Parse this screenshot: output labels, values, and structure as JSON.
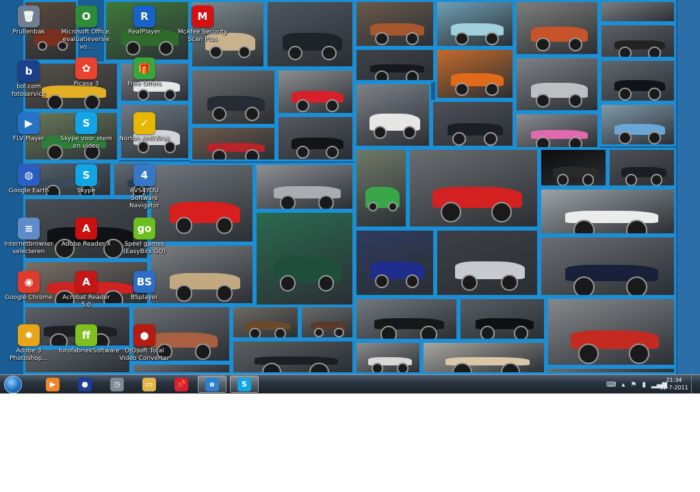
{
  "desktop": {
    "icons": [
      {
        "label": "Prullenbak",
        "icon": "recycle-bin-icon",
        "color": "#6f7f91",
        "glyph": "🗑"
      },
      {
        "label": "Microsoft Office, evaluatieversie vo...",
        "icon": "office-icon",
        "color": "#2f8a3a",
        "glyph": "O"
      },
      {
        "label": "RealPlayer",
        "icon": "realplayer-icon",
        "color": "#1763c9",
        "glyph": "R"
      },
      {
        "label": "McAfee Security Scan Plus",
        "icon": "mcafee-icon",
        "color": "#d41010",
        "glyph": "M"
      },
      {
        "label": "bol.com fotoservice",
        "icon": "bolcom-icon",
        "color": "#1c3f8a",
        "glyph": "b"
      },
      {
        "label": "Picasa 3",
        "icon": "picasa-icon",
        "color": "#e8432f",
        "glyph": "✿"
      },
      {
        "label": "Free Offers",
        "icon": "gift-icon",
        "color": "#3aa63a",
        "glyph": "🎁"
      },
      {
        "label": "FLV Player",
        "icon": "flv-player-icon",
        "color": "#2672c4",
        "glyph": "▶"
      },
      {
        "label": "Skype voor stem en video",
        "icon": "skype-icon",
        "color": "#12a5e6",
        "glyph": "S"
      },
      {
        "label": "Norton AntiVirus",
        "icon": "norton-icon",
        "color": "#e6b800",
        "glyph": "✓"
      },
      {
        "label": "Google Earth",
        "icon": "google-earth-icon",
        "color": "#2a5ec2",
        "glyph": "◍"
      },
      {
        "label": "Skype",
        "icon": "skype-icon",
        "color": "#12a5e6",
        "glyph": "S"
      },
      {
        "label": "AVS4YOU Software Navigator",
        "icon": "avs-navigator-icon",
        "color": "#3578c6",
        "glyph": "4"
      },
      {
        "label": "Internetbrowser selecteren",
        "icon": "browser-select-icon",
        "color": "#5e8cc9",
        "glyph": "≡"
      },
      {
        "label": "Adobe Reader X",
        "icon": "adobe-reader-icon",
        "color": "#c81010",
        "glyph": "A"
      },
      {
        "label": "Speel games (EasyBits GO)",
        "icon": "easybits-go-icon",
        "color": "#6cbf1e",
        "glyph": "go"
      },
      {
        "label": "Google Chrome",
        "icon": "chrome-icon",
        "color": "#dd3b2b",
        "glyph": "◉"
      },
      {
        "label": "Acrobat Reader 5.0",
        "icon": "acrobat-icon",
        "color": "#c41616",
        "glyph": "A"
      },
      {
        "label": "BSplayer",
        "icon": "bsplayer-icon",
        "color": "#2c6ec7",
        "glyph": "BS"
      },
      {
        "label": "Adobe 3 Photoshop...",
        "icon": "photoshop-album-icon",
        "color": "#e7a51a",
        "glyph": "✹"
      },
      {
        "label": "fotofabriekSoftware",
        "icon": "fotofabriek-icon",
        "color": "#7fbf1f",
        "glyph": "ff"
      },
      {
        "label": "OJOsoft Total Video Converter",
        "icon": "ojosoft-icon",
        "color": "#b51b12",
        "glyph": "●"
      }
    ]
  },
  "taskbar": {
    "apps": [
      {
        "name": "media-player",
        "icon": "media-player-icon",
        "color": "#f0862a",
        "glyph": "▶"
      },
      {
        "name": "media-center",
        "icon": "media-center-icon",
        "color": "#1d3d9c",
        "glyph": "●"
      },
      {
        "name": "clock-gadget",
        "icon": "clock-gadget-icon",
        "color": "#7f8a95",
        "glyph": "◷"
      },
      {
        "name": "explorer",
        "icon": "folder-icon",
        "color": "#e3b54a",
        "glyph": "▭"
      },
      {
        "name": "pin-tool",
        "icon": "pushpin-icon",
        "color": "#d8202a",
        "glyph": "📌"
      },
      {
        "name": "internet-explorer",
        "icon": "internet-explorer-icon",
        "color": "#2d7fd0",
        "glyph": "e"
      },
      {
        "name": "skype",
        "icon": "skype-icon",
        "color": "#12a5e6",
        "glyph": "S"
      }
    ],
    "clock": {
      "time": "21:34",
      "date": "12-7-2011"
    }
  }
}
